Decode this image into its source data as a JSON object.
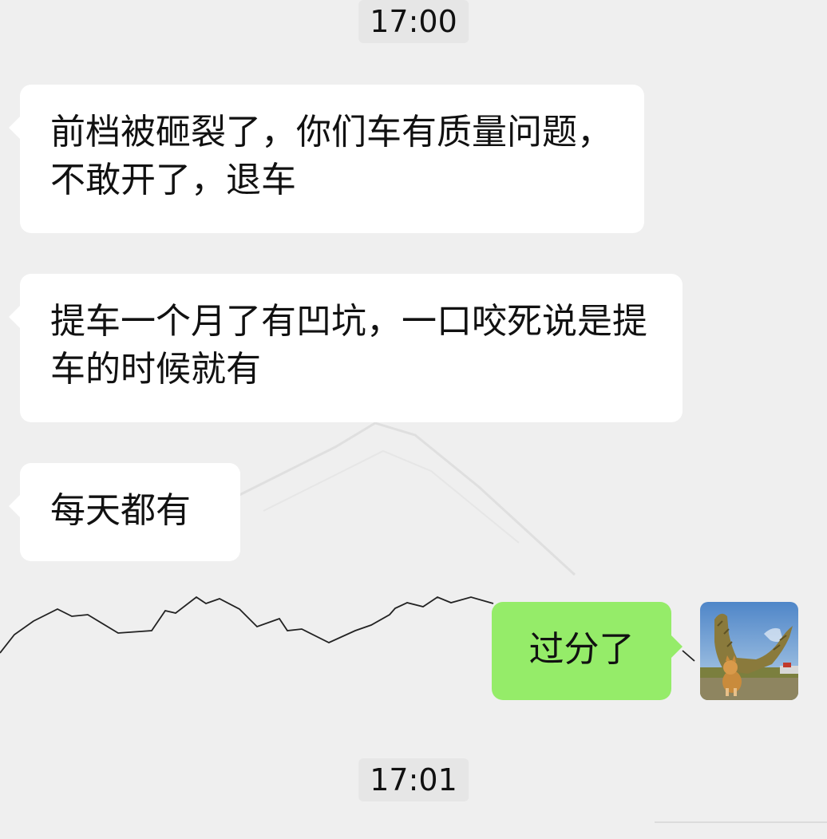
{
  "chat": {
    "timestamps": [
      "17:00",
      "17:01"
    ],
    "messages": [
      {
        "side": "received",
        "text": "前档被砸裂了，你们车有质量问题，不敢开了，退车"
      },
      {
        "side": "received",
        "text": "提车一个月了有凹坑，一口咬死说是提车的时候就有"
      },
      {
        "side": "received",
        "text": "每天都有"
      },
      {
        "side": "sent",
        "text": "过分了"
      }
    ]
  },
  "colors": {
    "background": "#efefef",
    "received_bubble": "#ffffff",
    "sent_bubble": "#95ec69",
    "timestamp_bg": "#e6e6e6"
  },
  "icons": {
    "avatar": "user-avatar-icon"
  }
}
